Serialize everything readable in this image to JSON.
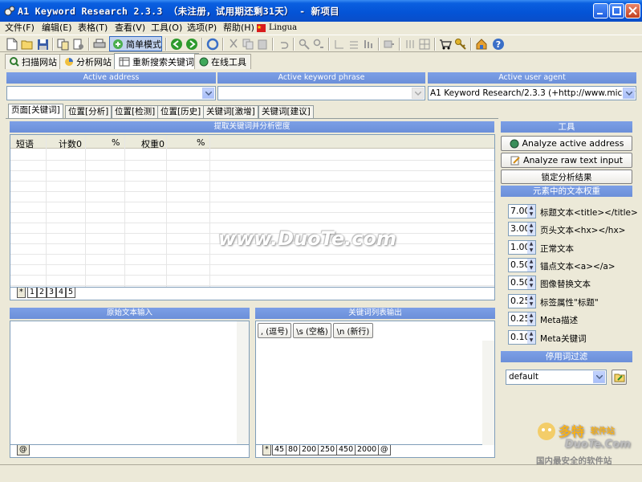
{
  "window": {
    "title": "A1 Keyword Research 2.3.3 （未注册，试用期还剩31天） - 新项目"
  },
  "menu": [
    "文件(F)",
    "编辑(E)",
    "表格(T)",
    "查看(V)",
    "工具(O)",
    "选项(P)",
    "帮助(H)"
  ],
  "menu_lingua": "Lingua",
  "toolbar": {
    "simple_mode": "简单模式"
  },
  "top_tabs": [
    "扫描网站",
    "分析网站",
    "重新搜索关键词",
    "在线工具"
  ],
  "address": {
    "active_address_label": "Active address",
    "active_keyword_label": "Active keyword phrase",
    "active_agent_label": "Active user agent",
    "agent_value": "A1 Keyword Research/2.3.3 (+http://www.microsys"
  },
  "sub_tabs": [
    "页面[关键词]",
    "位置[分析]",
    "位置[检测]",
    "位置[历史]",
    "关键词[激增]",
    "关键词[建议]"
  ],
  "keyword_panel": {
    "title": "提取关键词并分析密度",
    "columns": [
      "短语",
      "计数0",
      "%",
      "权重0",
      "%"
    ],
    "page_tabs": [
      "*",
      "1",
      "2",
      "3",
      "4",
      "5"
    ]
  },
  "source_panel": {
    "title": "原始文本输入",
    "tabs": [
      "@"
    ]
  },
  "output_panel": {
    "title": "关键词列表输出",
    "buttons": [
      ", (逗号)",
      "\\s (空格)",
      "\\n (新行)"
    ],
    "tabs": [
      "*",
      "45",
      "80",
      "200",
      "250",
      "450",
      "2000",
      "@"
    ]
  },
  "tools": {
    "title": "工具",
    "analyze_address": "Analyze active address",
    "analyze_raw": "Analyze raw text input",
    "lock_results": "锁定分析结果"
  },
  "weights": {
    "title": "元素中的文本权重",
    "items": [
      {
        "value": "7.00",
        "label": "标题文本<title></title>"
      },
      {
        "value": "3.00",
        "label": "页头文本<hx></hx>"
      },
      {
        "value": "1.00",
        "label": "正常文本"
      },
      {
        "value": "0.50",
        "label": "锚点文本<a></a>"
      },
      {
        "value": "0.50",
        "label": "图像替换文本"
      },
      {
        "value": "0.25",
        "label": "标签属性\"标题\""
      },
      {
        "value": "0.25",
        "label": "Meta描述"
      },
      {
        "value": "0.10",
        "label": "Meta关键词"
      }
    ]
  },
  "stopwords": {
    "title": "停用词过滤",
    "value": "default"
  },
  "watermark": {
    "text": "www.DuoTe.com",
    "logo1": "多特",
    "logo2": "软件站",
    "logo3": "DuoTe.Com",
    "logo4": "国内最安全的软件站"
  }
}
